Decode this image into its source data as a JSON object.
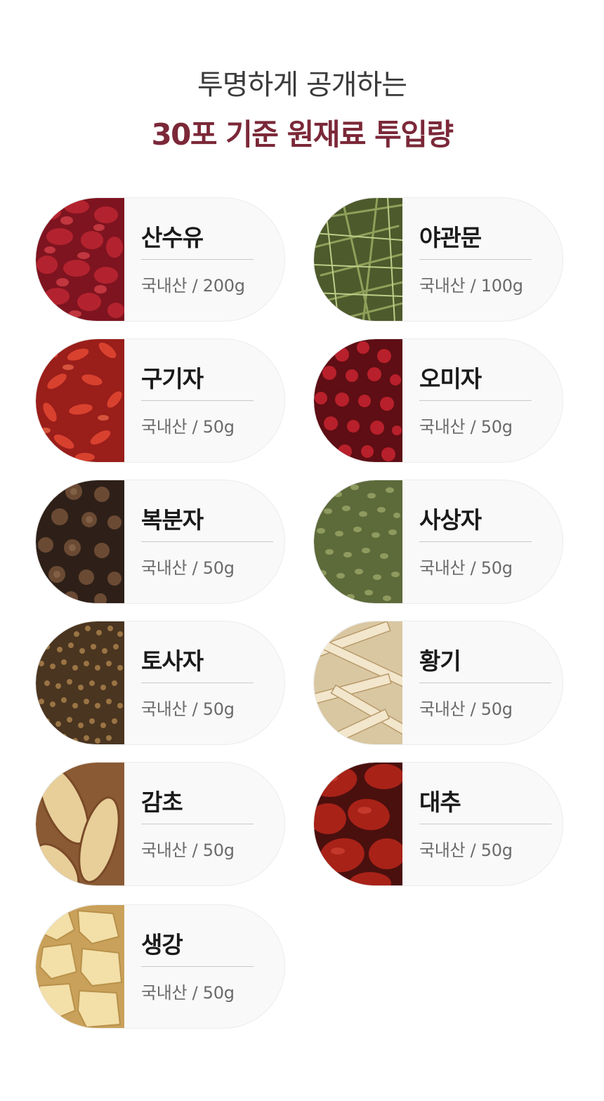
{
  "header": {
    "subtitle": "투명하게 공개하는",
    "title": "30포 기준 원재료 투입량"
  },
  "colors": {
    "title_accent": "#7b2838",
    "text_dark": "#1a1a1a",
    "text_muted": "#6a6a6a",
    "card_bg": "#f9f9f9"
  },
  "ingredients": [
    {
      "name": "산수유",
      "origin": "국내산 / 200g",
      "image": "dried-cornelian-cherry-image"
    },
    {
      "name": "야관문",
      "origin": "국내산 / 100g",
      "image": "dried-lespedeza-herb-image"
    },
    {
      "name": "구기자",
      "origin": "국내산 / 50g",
      "image": "dried-goji-berry-image"
    },
    {
      "name": "오미자",
      "origin": "국내산 / 50g",
      "image": "dried-schisandra-berry-image"
    },
    {
      "name": "복분자",
      "origin": "국내산 / 50g",
      "image": "dried-black-raspberry-image"
    },
    {
      "name": "사상자",
      "origin": "국내산 / 50g",
      "image": "cnidium-seed-image"
    },
    {
      "name": "토사자",
      "origin": "국내산 / 50g",
      "image": "dodder-seed-image"
    },
    {
      "name": "황기",
      "origin": "국내산 / 50g",
      "image": "astragalus-root-slices-image"
    },
    {
      "name": "감초",
      "origin": "국내산 / 50g",
      "image": "licorice-root-slices-image"
    },
    {
      "name": "대추",
      "origin": "국내산 / 50g",
      "image": "dried-jujube-image"
    },
    {
      "name": "생강",
      "origin": "국내산 / 50g",
      "image": "dried-ginger-slices-image"
    }
  ]
}
